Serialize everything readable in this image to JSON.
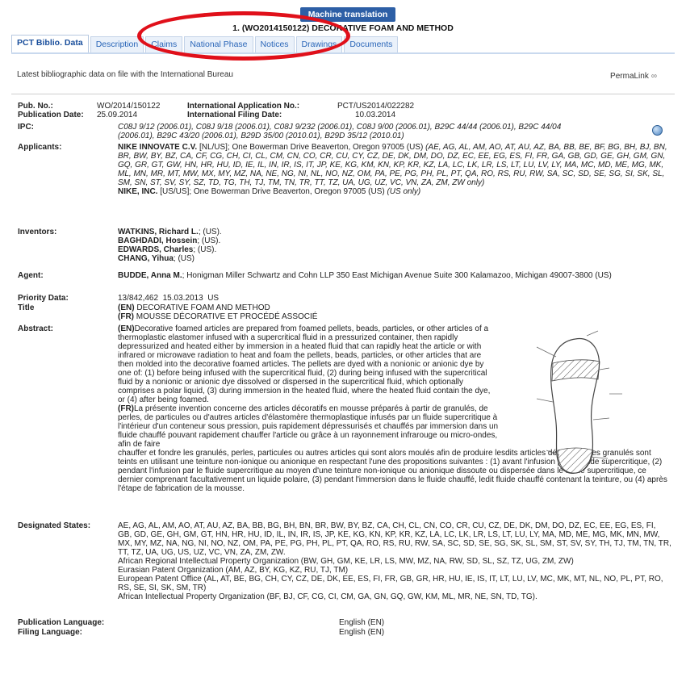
{
  "header": {
    "machine_translation_label": "Machine translation",
    "doc_title": "1. (WO2014150122) DECORATIVE FOAM AND METHOD"
  },
  "tabs": [
    {
      "label": "PCT Biblio. Data"
    },
    {
      "label": "Description"
    },
    {
      "label": "Claims"
    },
    {
      "label": "National Phase"
    },
    {
      "label": "Notices"
    },
    {
      "label": "Drawings"
    },
    {
      "label": "Documents"
    }
  ],
  "subheader": {
    "latest": "Latest bibliographic data on file with the International Bureau",
    "permalink": "PermaLink",
    "permalink_icon": "link-icon"
  },
  "biblio": {
    "pub_no_label": "Pub. No.:",
    "pub_no": "WO/2014/150122",
    "pub_date_label": "Publication Date:",
    "pub_date": "25.09.2014",
    "intl_app_label": "International Application No.:",
    "intl_app": "PCT/US2014/022282",
    "intl_filing_label": "International Filing Date:",
    "intl_filing": "10.03.2014",
    "ipc_label": "IPC:",
    "ipc_line1": "C08J 9/12 (2006.01), C08J 9/18 (2006.01), C08J 9/232 (2006.01), C08J 9/00 (2006.01), B29C 44/44 (2006.01), B29C 44/04",
    "ipc_line2": "(2006.01), B29C 43/20 (2006.01), B29D 35/00 (2010.01), B29D 35/12 (2010.01)",
    "applicants_label": "Applicants:",
    "applicant1_name": "NIKE INNOVATE C.V.",
    "applicant1_rest": " [NL/US]; One Bowerman Drive Beaverton, Oregon 97005 (US) ",
    "applicant1_states": "(AE, AG, AL, AM, AO, AT, AU, AZ, BA, BB, BE, BF, BG, BH, BJ, BN, BR, BW, BY, BZ, CA, CF, CG, CH, CI, CL, CM, CN, CO, CR, CU, CY, CZ, DE, DK, DM, DO, DZ, EC, EE, EG, ES, FI, FR, GA, GB, GD, GE, GH, GM, GN, GQ, GR, GT, GW, HN, HR, HU, ID, IE, IL, IN, IR, IS, IT, JP, KE, KG, KM, KN, KP, KR, KZ, LA, LC, LK, LR, LS, LT, LU, LV, LY, MA, MC, MD, ME, MG, MK, ML, MN, MR, MT, MW, MX, MY, MZ, NA, NE, NG, NI, NL, NO, NZ, OM, PA, PE, PG, PH, PL, PT, QA, RO, RS, RU, RW, SA, SC, SD, SE, SG, SI, SK, SL, SM, SN, ST, SV, SY, SZ, TD, TG, TH, TJ, TM, TN, TR, TT, TZ, UA, UG, UZ, VC, VN, ZA, ZM, ZW only)",
    "applicant2_name": "NIKE, INC.",
    "applicant2_rest": " [US/US]; One Bowerman Drive Beaverton, Oregon 97005 (US) ",
    "applicant2_states": "(US only)",
    "inventors_label": "Inventors:",
    "inventors": [
      {
        "name": "WATKINS, Richard L.",
        "rest": "; (US)."
      },
      {
        "name": "BAGHDADI, Hossein",
        "rest": "; (US)."
      },
      {
        "name": "EDWARDS, Charles",
        "rest": "; (US)."
      },
      {
        "name": "CHANG, Yihua",
        "rest": "; (US)"
      }
    ],
    "agent_label": "Agent:",
    "agent_name": "BUDDE, Anna M.",
    "agent_rest": "; Honigman Miller Schwartz and Cohn LLP 350 East Michigan Avenue Suite 300 Kalamazoo, Michigan 49007-3800 (US)",
    "priority_label": "Priority Data:",
    "priority": "13/842,462  15.03.2013  US",
    "title_label": "Title",
    "title_en_tag": "(EN)",
    "title_en": " DECORATIVE FOAM AND METHOD",
    "title_fr_tag": "(FR)",
    "title_fr": " MOUSSE DÉCORATIVE ET PROCÉDÉ ASSOCIÉ",
    "abstract_label": "Abstract:",
    "abstract_en_tag": "(EN)",
    "abstract_en": "Decorative foamed articles are prepared from foamed pellets, beads, particles, or other articles of a thermoplastic elastomer infused with a supercritical fluid in a pressurized container, then rapidly depressurized and heated either by immersion in a heated fluid that can rapidly heat the article or with infrared or microwave radiation to heat and foam the pellets, beads, particles, or other articles that are then molded into the decorative foamed articles. The pellets are dyed with a nonionic or anionic dye by one of: (1) before being infused with the supercritical fluid, (2) during being infused with the supercritical fluid by a nonionic or anionic dye dissolved or dispersed in the supercritical fluid, which optionally comprises a polar liquid, (3) during immersion in the heated fluid, where the heated fluid contain the dye, or (4) after being foamed.",
    "abstract_fr_tag": "(FR)",
    "abstract_fr_narrow": "La présente invention concerne des articles décoratifs en mousse préparés à partir de granulés, de perles, de particules ou d'autres articles d'élastomère thermoplastique infusés par un fluide supercritique à l'intérieur d'un conteneur sous pression, puis rapidement dépressurisés et chauffés par immersion dans un fluide chauffé pouvant rapidement chauffer l'article ou grâce à un rayonnement infrarouge ou micro-ondes, afin de faire",
    "abstract_fr_wide": "chauffer et fondre les granulés, perles, particules ou autres articles qui sont alors moulés afin de produire lesdits articles décoratifs. Les granulés sont teints en utilisant une teinture non-ionique ou anionique en respectant l'une des propositions suivantes : (1) avant l'infusion par le fluide supercritique, (2) pendant l'infusion par le fluide supercritique au moyen d'une teinture non-ionique ou anionique dissoute ou dispersée dans le fluide supercritique, ce dernier comprenant facultativement un liquide polaire, (3) pendant l'immersion dans le fluide chauffé, ledit fluide chauffé contenant la teinture, ou (4) après l'étape de fabrication de la mousse.",
    "designated_label": "Designated States:",
    "designated_main": "AE, AG, AL, AM, AO, AT, AU, AZ, BA, BB, BG, BH, BN, BR, BW, BY, BZ, CA, CH, CL, CN, CO, CR, CU, CZ, DE, DK, DM, DO, DZ, EC, EE, EG, ES, FI, GB, GD, GE, GH, GM, GT, HN, HR, HU, ID, IL, IN, IR, IS, JP, KE, KG, KN, KP, KR, KZ, LA, LC, LK, LR, LS, LT, LU, LY, MA, MD, ME, MG, MK, MN, MW, MX, MY, MZ, NA, NG, NI, NO, NZ, OM, PA, PE, PG, PH, PL, PT, QA, RO, RS, RU, RW, SA, SC, SD, SE, SG, SK, SL, SM, ST, SV, SY, TH, TJ, TM, TN, TR, TT, TZ, UA, UG, US, UZ, VC, VN, ZA, ZM, ZW.",
    "designated_aripo": "African Regional Intellectual Property Organization (BW, GH, GM, KE, LR, LS, MW, MZ, NA, RW, SD, SL, SZ, TZ, UG, ZM, ZW)",
    "designated_eurasian": "Eurasian Patent Organization (AM, AZ, BY, KG, KZ, RU, TJ, TM)",
    "designated_epo": "European Patent Office (AL, AT, BE, BG, CH, CY, CZ, DE, DK, EE, ES, FI, FR, GB, GR, HR, HU, IE, IS, IT, LT, LU, LV, MC, MK, MT, NL, NO, PL, PT, RO, RS, SE, SI, SK, SM, TR)",
    "designated_oapi": "African Intellectual Property Organization (BF, BJ, CF, CG, CI, CM, GA, GN, GQ, GW, KM, ML, MR, NE, SN, TD, TG).",
    "pub_lang_label": "Publication Language:",
    "pub_lang": "English (EN)",
    "filing_lang_label": "Filing Language:",
    "filing_lang": "English (EN)"
  },
  "colors": {
    "accent": "#2d5fa6",
    "tab_text": "#2a66b8",
    "annotation": "#e0101a"
  }
}
